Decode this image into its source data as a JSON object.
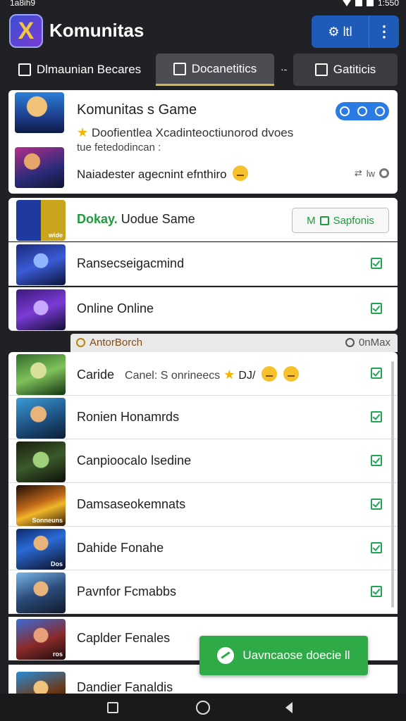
{
  "status_bar": {
    "time": "1a8ih9",
    "battery": "1:550"
  },
  "app": {
    "title": "Komunitas",
    "logo_letter": "X",
    "settings_label": "ltl",
    "more_glyph": "⋮"
  },
  "tabs": [
    {
      "label": "Dlmaunian Becares",
      "icon": "document-icon"
    },
    {
      "label": "Docanetitics",
      "icon": "person-icon",
      "active": true
    },
    {
      "label": "Gatiticis",
      "icon": "group-icon"
    }
  ],
  "tab_separator": "·-",
  "featured": {
    "title": "Komunitas s Game",
    "desc_line1": "Doofientlea Xcadinteoctiunorod dvoes",
    "desc_line2": "tue fetedodincan :",
    "note": "Naiadester agecnint efnthiro",
    "meta": "lw"
  },
  "rows": [
    {
      "label_strong": "Dokay.",
      "label_rest": " Uodue Same",
      "thumb_tag": "wide",
      "option_label": "Sapfonis",
      "option_prefix": "M"
    },
    {
      "label": "Ransecseigacmind"
    },
    {
      "label": "Online Online"
    }
  ],
  "section": {
    "left": "AntorBorch",
    "right": "0nMax"
  },
  "rows2": [
    {
      "label": "Caride",
      "extra": "Canel: S onrineecs",
      "extra2": "DJ/"
    },
    {
      "label": "Ronien Honamrds"
    },
    {
      "label": "Canpioocalo lsedine"
    },
    {
      "label": "Damsaseokemnats",
      "thumb_tag": "Sonneuns"
    },
    {
      "label": "Dahide Fonahe",
      "thumb_tag": "Dos"
    },
    {
      "label": "Pavnfor Fcmabbs"
    },
    {
      "label": "Caplder Fenales",
      "thumb_tag": "ros"
    },
    {
      "label": "Dandier Fanaldis"
    }
  ],
  "fab": {
    "label": "Uavncaose doecie ll"
  },
  "colors": {
    "accent": "#1e5bb8",
    "success": "#2eaa46",
    "background": "#202124"
  }
}
